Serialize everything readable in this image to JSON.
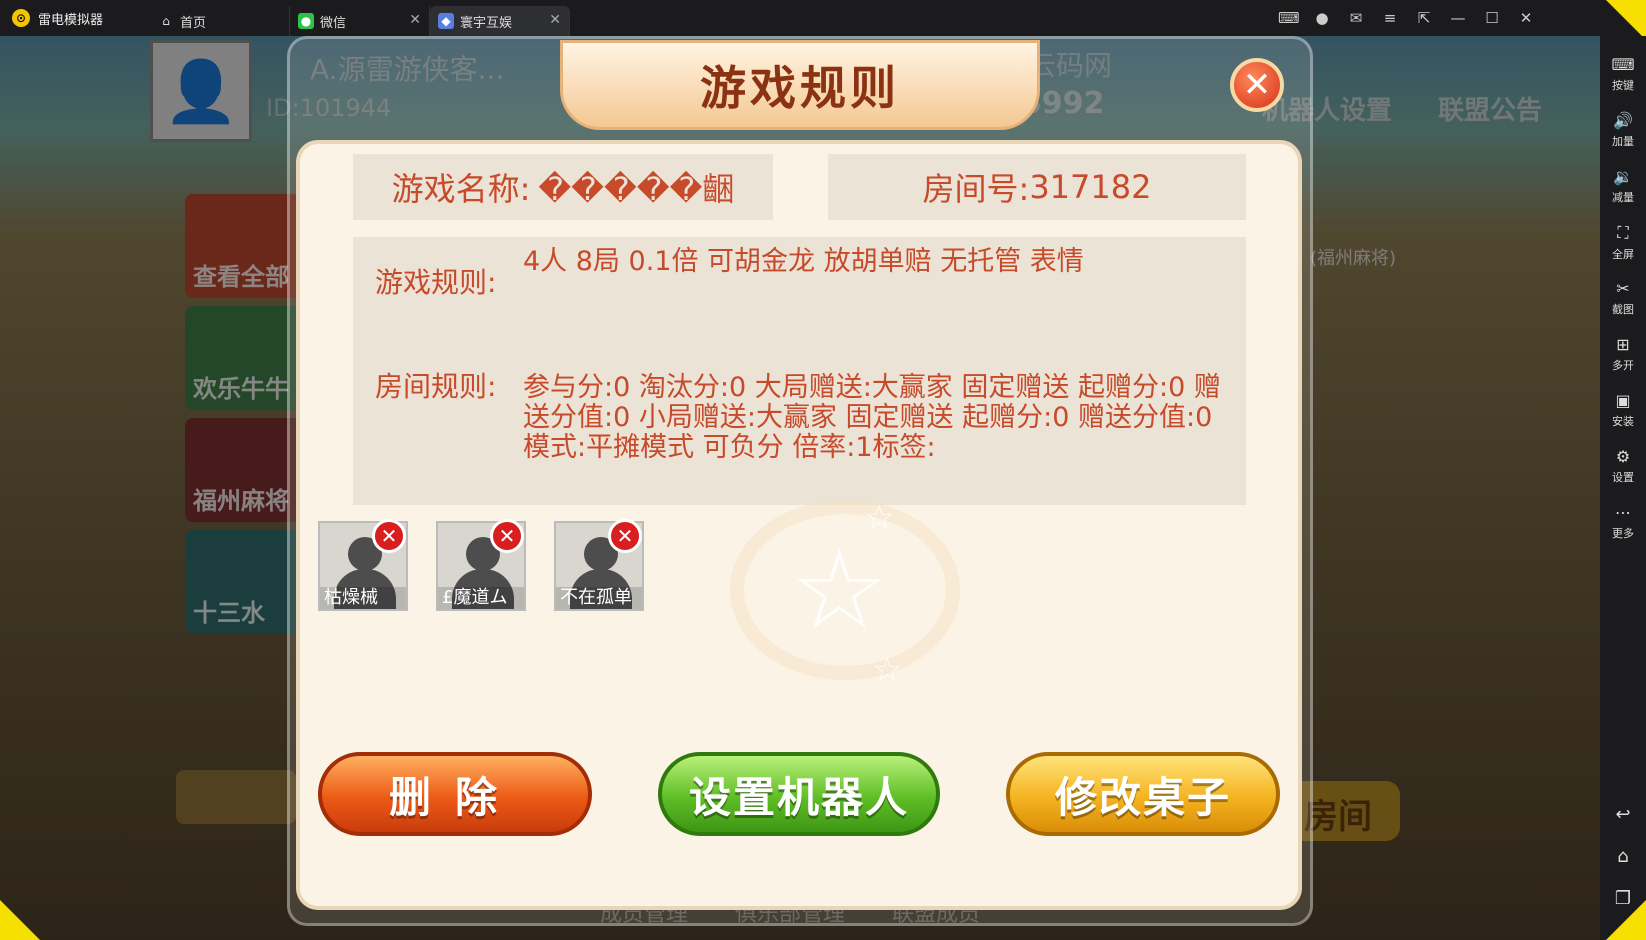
{
  "emulator": {
    "app_name": "雷电模拟器",
    "tabs": [
      {
        "label": "首页",
        "closable": false,
        "active": false
      },
      {
        "label": "微信",
        "closable": true,
        "active": false
      },
      {
        "label": "寰宇互娱",
        "closable": true,
        "active": true
      }
    ],
    "sidebar": [
      {
        "label": "按键",
        "icon": "keyboard-icon"
      },
      {
        "label": "加量",
        "icon": "volume-up-icon"
      },
      {
        "label": "减量",
        "icon": "volume-down-icon"
      },
      {
        "label": "全屏",
        "icon": "fullscreen-icon"
      },
      {
        "label": "截图",
        "icon": "scissors-icon"
      },
      {
        "label": "多开",
        "icon": "multi-open-icon"
      },
      {
        "label": "安装",
        "icon": "apk-icon"
      },
      {
        "label": "设置",
        "icon": "gear-icon"
      },
      {
        "label": "更多",
        "icon": "more-icon"
      }
    ],
    "accent": "#f5e000"
  },
  "background": {
    "player_name": "A.源雷游侠客...",
    "player_id": "ID:101944",
    "site_text": "云码网",
    "number_text": "15992",
    "robot_settings": "机器人设置",
    "alliance_notice": "联盟公告",
    "menu_items": [
      "查看全部",
      "欢乐牛牛",
      "福州麻将",
      "十三水"
    ],
    "table_label": "(福州麻将)",
    "room_button": "房间",
    "bottom_menu": "成员管理 俱乐部管理 联盟成员"
  },
  "dialog": {
    "title": "游戏规则",
    "game_name_label": "游戏名称:",
    "game_name_value": "�����齫",
    "room_label": "房间号:",
    "room_value": "317182",
    "game_rules_label": "游戏规则:",
    "game_rules_text": "4人   8局   0.1倍   可胡金龙    放胡单赔    无托管 表情",
    "room_rules_label": "房间规则:",
    "room_rules_text": "参与分:0  淘汰分:0  大局赠送:大赢家 固定赠送  起赠分:0 赠送分值:0  小局赠送:大赢家 固定赠送   起赠分:0  赠送分值:0 模式:平摊模式 可负分  倍率:1标签:",
    "players": [
      {
        "name": "枯燥械"
      },
      {
        "name": "£魔道ム"
      },
      {
        "name": "不在孤单"
      }
    ],
    "buttons": {
      "delete": "删除",
      "set_robot": "设置机器人",
      "modify_table": "修改桌子"
    }
  }
}
